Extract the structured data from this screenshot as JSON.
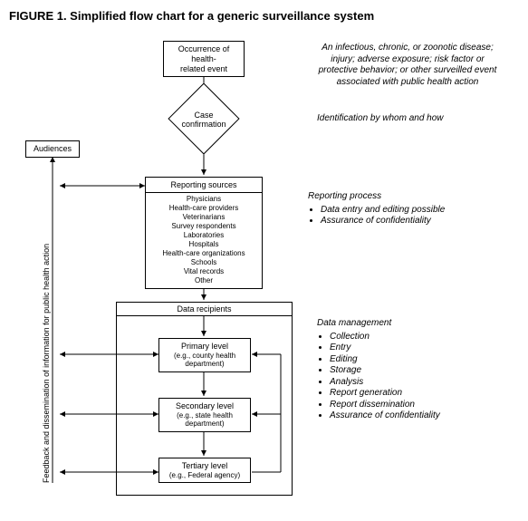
{
  "title": "FIGURE 1. Simplified flow chart for a generic surveillance system",
  "nodes": {
    "occurrence": "Occurrence of health-\nrelated event",
    "case_conf": "Case\nconfirmation",
    "audiences": "Audiences",
    "reporting_sources": "Reporting sources",
    "sources_list": [
      "Physicians",
      "Health-care providers",
      "Veterinarians",
      "Survey respondents",
      "Laboratories",
      "Hospitals",
      "Health-care organizations",
      "Schools",
      "Vital records",
      "Other"
    ],
    "data_recipients": "Data recipients",
    "primary": {
      "label": "Primary level",
      "example": "(e.g., county health\ndepartment)"
    },
    "secondary": {
      "label": "Secondary level",
      "example": "(e.g., state health\ndepartment)"
    },
    "tertiary": {
      "label": "Tertiary level",
      "example": "(e.g., Federal agency)"
    }
  },
  "annotations": {
    "occurrence": "An infectious, chronic, or zoonotic disease;\ninjury; adverse exposure;  risk factor or\nprotective behavior; or other surveilled event\nassociated with public health action",
    "case_conf": "Identification by whom and how",
    "reporting": {
      "header": "Reporting process",
      "bullets": [
        "Data entry and editing possible",
        "Assurance of confidentiality"
      ]
    },
    "data_mgmt": {
      "header": "Data management",
      "bullets": [
        "Collection",
        "Entry",
        "Editing",
        "Storage",
        "Analysis",
        "Report generation",
        "Report dissemination",
        "Assurance of confidentiality"
      ]
    }
  },
  "feedback_label": "Feedback and dissemination of information for public health action"
}
